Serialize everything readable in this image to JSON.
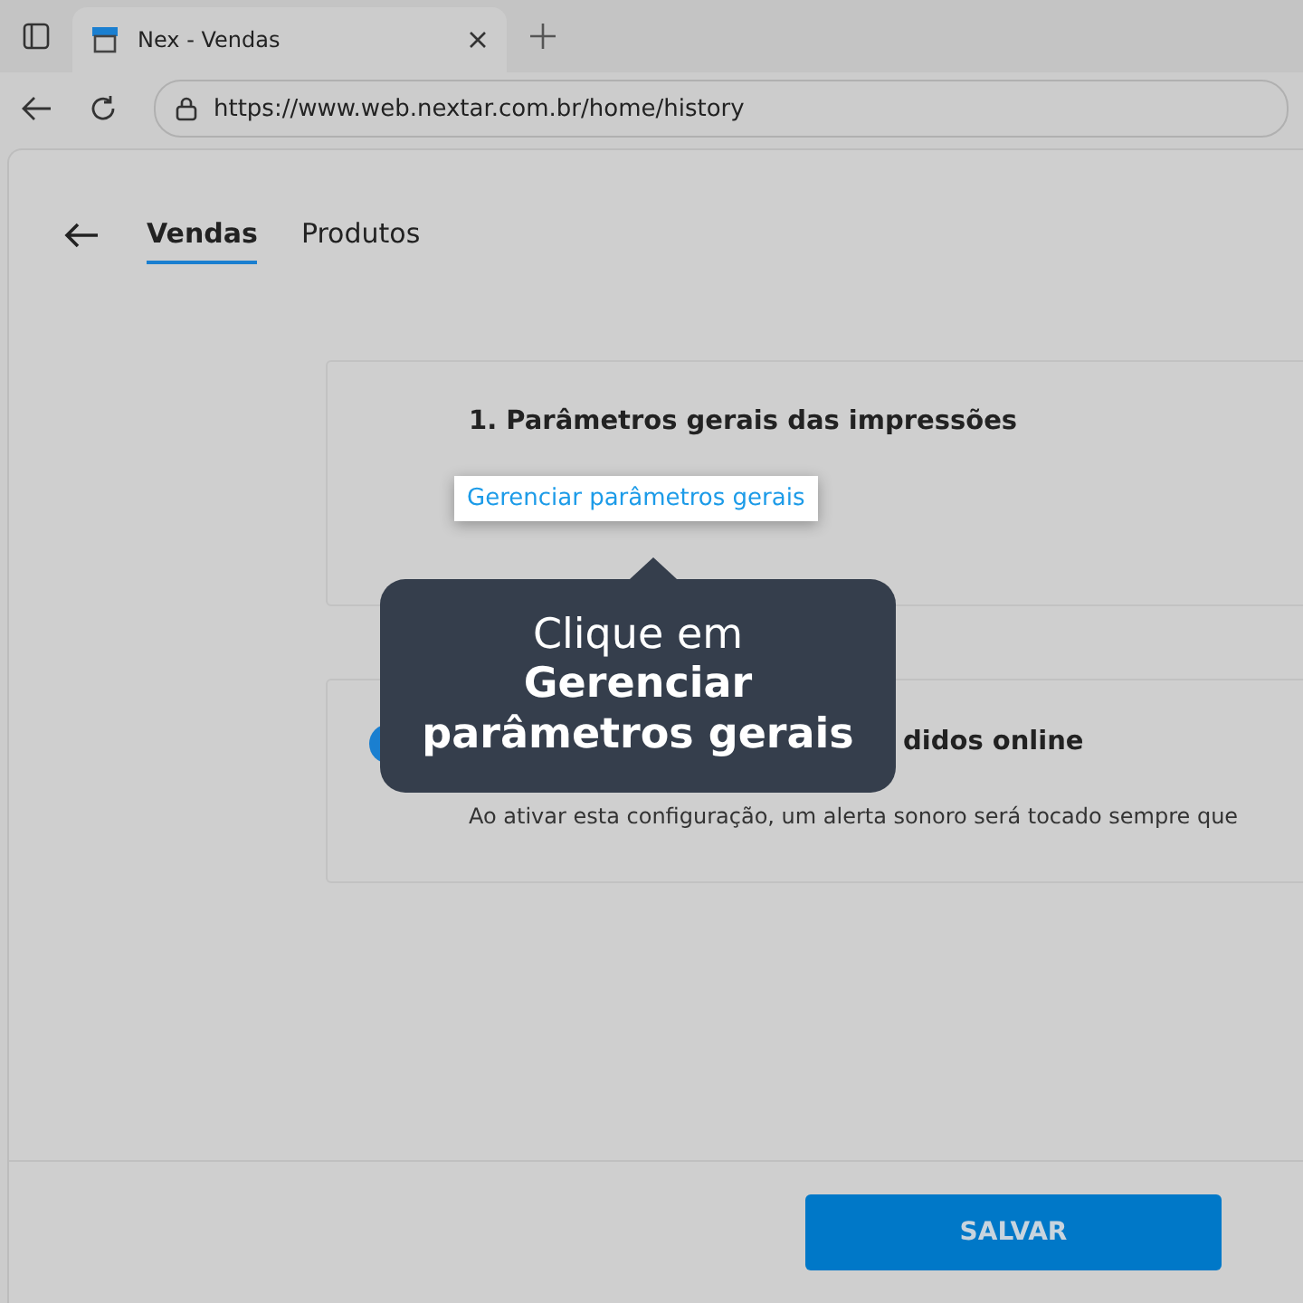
{
  "browser": {
    "tab_title": "Nex - Vendas",
    "url": "https://www.web.nextar.com.br/home/history"
  },
  "tabs": [
    {
      "label": "Vendas",
      "selected": true
    },
    {
      "label": "Produtos",
      "selected": false
    }
  ],
  "sections": [
    {
      "title": "1. Parâmetros gerais das impressões",
      "link": "Gerenciar parâmetros gerais"
    },
    {
      "title": "didos online",
      "description": "Ao ativar esta configuração, um alerta sonoro será tocado sempre que"
    }
  ],
  "tooltip": {
    "line": "Clique em",
    "emphasis": "Gerenciar parâmetros gerais"
  },
  "footer": {
    "button": "SALVAR"
  }
}
